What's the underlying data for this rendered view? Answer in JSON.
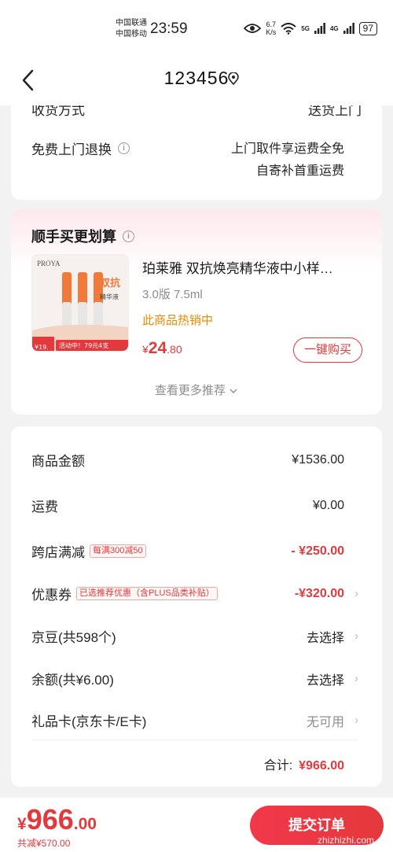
{
  "status_bar": {
    "carrier1": "中国联通",
    "carrier2": "中国移动",
    "time": "23:59",
    "net_speed_value": "6.7",
    "net_speed_unit": "K/s",
    "signal1": "5G",
    "signal2": "4G",
    "battery": "97"
  },
  "nav": {
    "title": "123456"
  },
  "delivery": {
    "clipped_label": "收货方式",
    "clipped_value": "送货上门",
    "return_label": "免费上门退换",
    "return_line1": "上门取件享运费全免",
    "return_line2": "自寄补首重运费"
  },
  "recommend": {
    "title": "顺手买更划算",
    "product_name": "珀莱雅 双抗焕亮精华液中小样…",
    "spec": "3.0版 7.5ml",
    "hot_tag": "此商品热销中",
    "price_symbol": "¥",
    "price_int": "24",
    "price_dec": ".80",
    "buy_label": "一键购买",
    "more_label": "查看更多推荐",
    "image_brand": "PROYA",
    "image_promo1": "双抗",
    "image_promo2": "精华液",
    "image_badge": "活动中！79元4支",
    "image_price": "¥19."
  },
  "fees": {
    "goods_label": "商品金额",
    "goods_value": "¥1536.00",
    "shipping_label": "运费",
    "shipping_value": "¥0.00",
    "cross_label": "跨店满减",
    "cross_tag": "每满300减50",
    "cross_value": "- ¥250.00",
    "coupon_label": "优惠券",
    "coupon_tag": "已选推荐优惠（含PLUS品类补贴）",
    "coupon_value": "-¥320.00",
    "jd_beans_label": "京豆(共598个)",
    "jd_beans_value": "去选择",
    "balance_label": "余额(共¥6.00)",
    "balance_value": "去选择",
    "gift_card_label": "礼品卡(京东卡/E卡)",
    "gift_card_value": "无可用",
    "total_label": "合计:",
    "total_value": "¥966.00"
  },
  "bottom": {
    "price_symbol": "¥",
    "price_int": "966",
    "price_dec": ".00",
    "saved": "共减¥570.00",
    "submit_label": "提交订单",
    "watermark": "zhizhizhi.com"
  },
  "colors": {
    "accent": "#e4393c",
    "hot": "#e98a00"
  }
}
